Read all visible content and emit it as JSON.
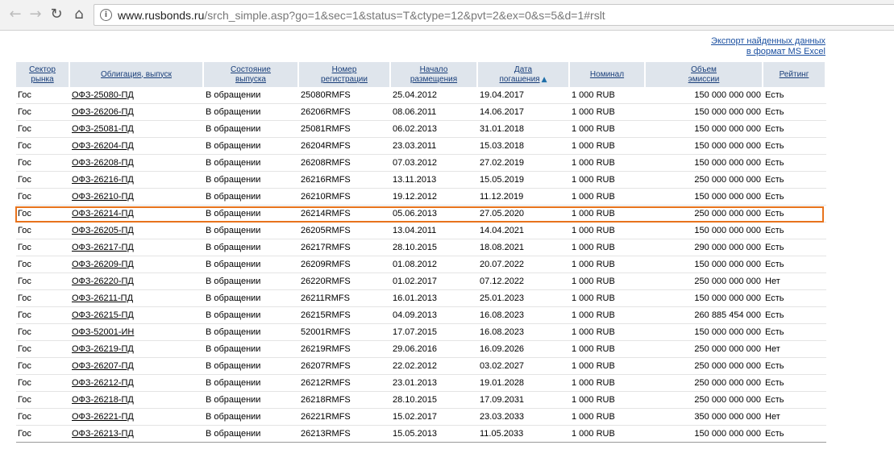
{
  "browser": {
    "url_host": "www.rusbonds.ru",
    "url_path": "/srch_simple.asp?go=1&sec=1&status=T&ctype=12&pvt=2&ex=0&s=5&d=1#rslt"
  },
  "export": {
    "line1": "Экспорт найденных данных",
    "line2": "в формат MS Excel"
  },
  "columns": [
    {
      "l1": "Сектор",
      "l2": "рынка"
    },
    {
      "l1": "Облигация, выпуск",
      "l2": ""
    },
    {
      "l1": "Состояние",
      "l2": "выпуска"
    },
    {
      "l1": "Номер",
      "l2": "регистрации"
    },
    {
      "l1": "Начало",
      "l2": "размещения"
    },
    {
      "l1": "Дата",
      "l2": "погашения"
    },
    {
      "l1": "Номинал",
      "l2": ""
    },
    {
      "l1": "Объем",
      "l2": "эмиссии"
    },
    {
      "l1": "Рейтинг",
      "l2": ""
    }
  ],
  "rows": [
    [
      "Гос",
      "ОФЗ-25080-ПД",
      "В обращении",
      "25080RMFS",
      "25.04.2012",
      "19.04.2017",
      "1 000 RUB",
      "150 000 000 000",
      "Есть"
    ],
    [
      "Гос",
      "ОФЗ-26206-ПД",
      "В обращении",
      "26206RMFS",
      "08.06.2011",
      "14.06.2017",
      "1 000 RUB",
      "150 000 000 000",
      "Есть"
    ],
    [
      "Гос",
      "ОФЗ-25081-ПД",
      "В обращении",
      "25081RMFS",
      "06.02.2013",
      "31.01.2018",
      "1 000 RUB",
      "150 000 000 000",
      "Есть"
    ],
    [
      "Гос",
      "ОФЗ-26204-ПД",
      "В обращении",
      "26204RMFS",
      "23.03.2011",
      "15.03.2018",
      "1 000 RUB",
      "150 000 000 000",
      "Есть"
    ],
    [
      "Гос",
      "ОФЗ-26208-ПД",
      "В обращении",
      "26208RMFS",
      "07.03.2012",
      "27.02.2019",
      "1 000 RUB",
      "150 000 000 000",
      "Есть"
    ],
    [
      "Гос",
      "ОФЗ-26216-ПД",
      "В обращении",
      "26216RMFS",
      "13.11.2013",
      "15.05.2019",
      "1 000 RUB",
      "250 000 000 000",
      "Есть"
    ],
    [
      "Гос",
      "ОФЗ-26210-ПД",
      "В обращении",
      "26210RMFS",
      "19.12.2012",
      "11.12.2019",
      "1 000 RUB",
      "150 000 000 000",
      "Есть"
    ],
    [
      "Гос",
      "ОФЗ-26214-ПД",
      "В обращении",
      "26214RMFS",
      "05.06.2013",
      "27.05.2020",
      "1 000 RUB",
      "250 000 000 000",
      "Есть"
    ],
    [
      "Гос",
      "ОФЗ-26205-ПД",
      "В обращении",
      "26205RMFS",
      "13.04.2011",
      "14.04.2021",
      "1 000 RUB",
      "150 000 000 000",
      "Есть"
    ],
    [
      "Гос",
      "ОФЗ-26217-ПД",
      "В обращении",
      "26217RMFS",
      "28.10.2015",
      "18.08.2021",
      "1 000 RUB",
      "290 000 000 000",
      "Есть"
    ],
    [
      "Гос",
      "ОФЗ-26209-ПД",
      "В обращении",
      "26209RMFS",
      "01.08.2012",
      "20.07.2022",
      "1 000 RUB",
      "150 000 000 000",
      "Есть"
    ],
    [
      "Гос",
      "ОФЗ-26220-ПД",
      "В обращении",
      "26220RMFS",
      "01.02.2017",
      "07.12.2022",
      "1 000 RUB",
      "250 000 000 000",
      "Нет"
    ],
    [
      "Гос",
      "ОФЗ-26211-ПД",
      "В обращении",
      "26211RMFS",
      "16.01.2013",
      "25.01.2023",
      "1 000 RUB",
      "150 000 000 000",
      "Есть"
    ],
    [
      "Гос",
      "ОФЗ-26215-ПД",
      "В обращении",
      "26215RMFS",
      "04.09.2013",
      "16.08.2023",
      "1 000 RUB",
      "260 885 454 000",
      "Есть"
    ],
    [
      "Гос",
      "ОФЗ-52001-ИН",
      "В обращении",
      "52001RMFS",
      "17.07.2015",
      "16.08.2023",
      "1 000 RUB",
      "150 000 000 000",
      "Есть"
    ],
    [
      "Гос",
      "ОФЗ-26219-ПД",
      "В обращении",
      "26219RMFS",
      "29.06.2016",
      "16.09.2026",
      "1 000 RUB",
      "250 000 000 000",
      "Нет"
    ],
    [
      "Гос",
      "ОФЗ-26207-ПД",
      "В обращении",
      "26207RMFS",
      "22.02.2012",
      "03.02.2027",
      "1 000 RUB",
      "250 000 000 000",
      "Есть"
    ],
    [
      "Гос",
      "ОФЗ-26212-ПД",
      "В обращении",
      "26212RMFS",
      "23.01.2013",
      "19.01.2028",
      "1 000 RUB",
      "250 000 000 000",
      "Есть"
    ],
    [
      "Гос",
      "ОФЗ-26218-ПД",
      "В обращении",
      "26218RMFS",
      "28.10.2015",
      "17.09.2031",
      "1 000 RUB",
      "250 000 000 000",
      "Есть"
    ],
    [
      "Гос",
      "ОФЗ-26221-ПД",
      "В обращении",
      "26221RMFS",
      "15.02.2017",
      "23.03.2033",
      "1 000 RUB",
      "350 000 000 000",
      "Нет"
    ],
    [
      "Гос",
      "ОФЗ-26213-ПД",
      "В обращении",
      "26213RMFS",
      "15.05.2013",
      "11.05.2033",
      "1 000 RUB",
      "150 000 000 000",
      "Есть"
    ]
  ],
  "highlighted_row": "ОФЗ-26214-ПД",
  "colors": {
    "header_bg": "#dfe5ec",
    "header_text": "#1a3f7a",
    "highlight": "#e8731c",
    "link": "#1a4fa0"
  }
}
